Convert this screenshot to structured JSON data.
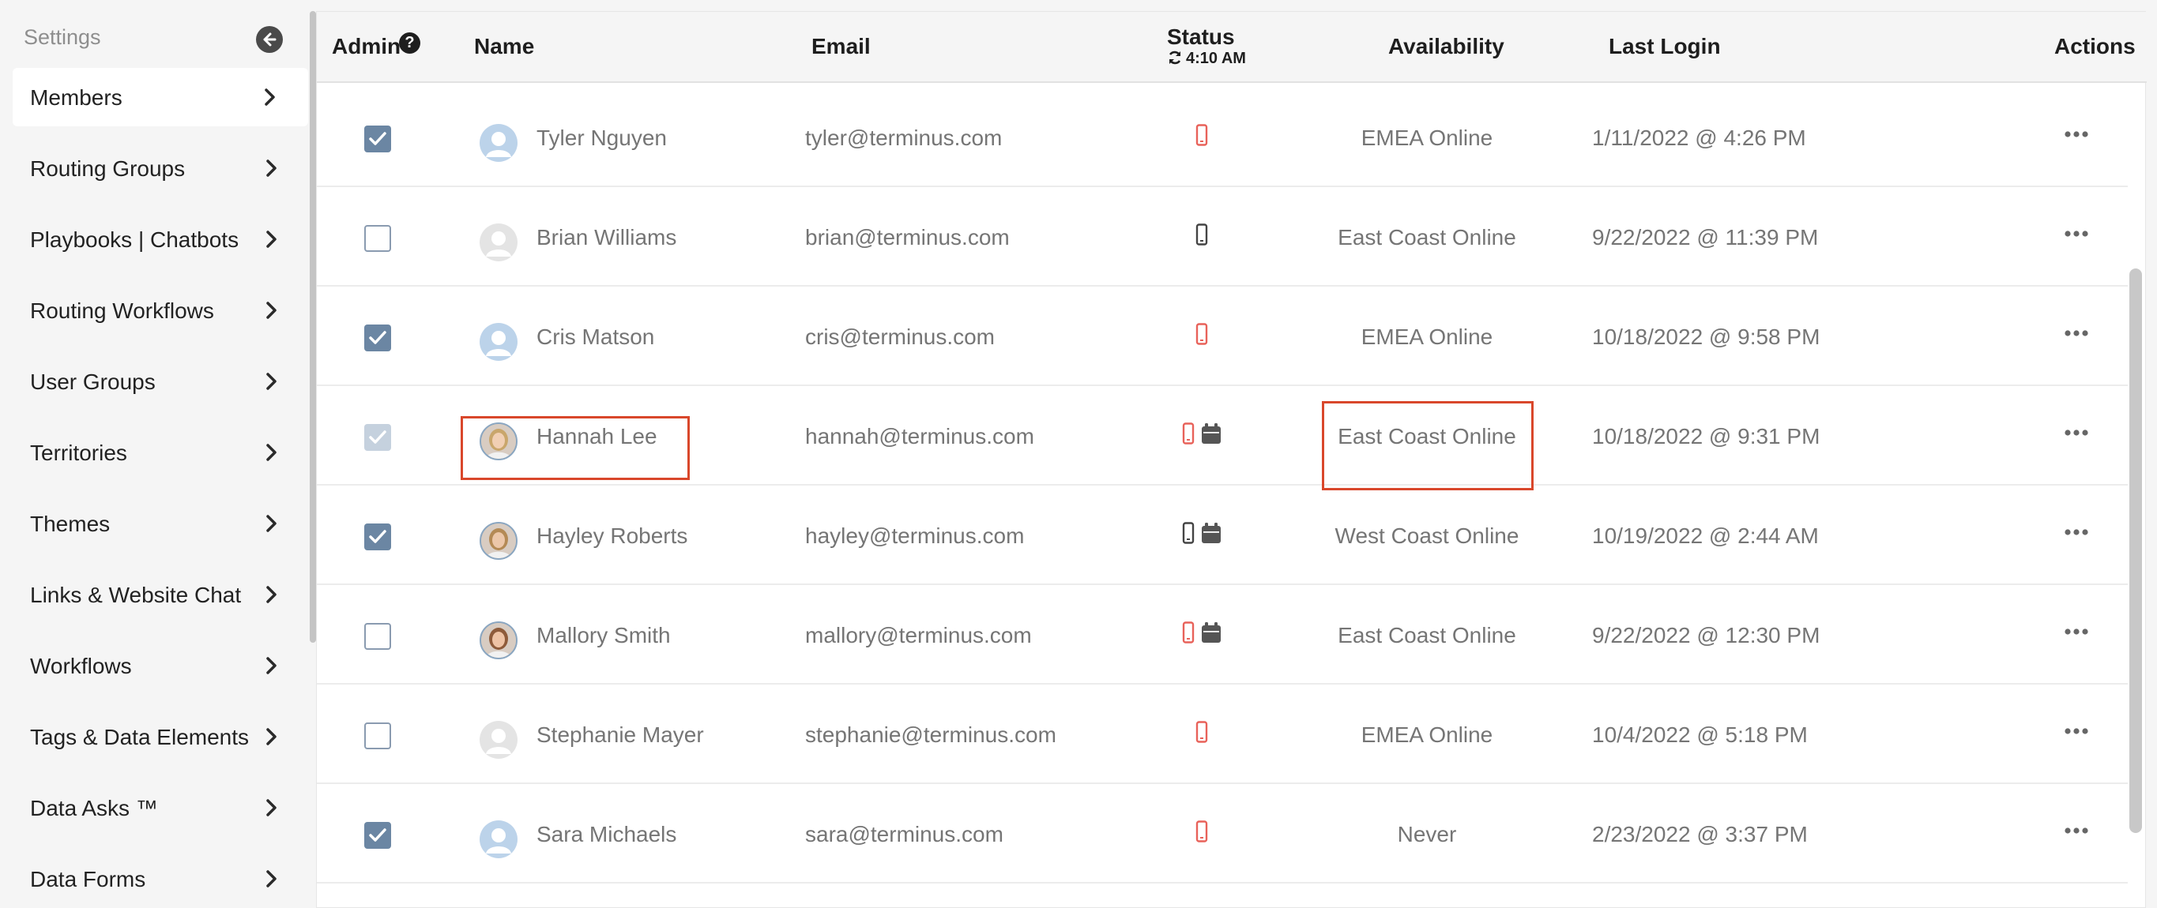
{
  "sidebar": {
    "title": "Settings",
    "items": [
      {
        "label": "Members",
        "active": true
      },
      {
        "label": "Routing Groups"
      },
      {
        "label": "Playbooks | Chatbots"
      },
      {
        "label": "Routing Workflows"
      },
      {
        "label": "User Groups"
      },
      {
        "label": "Territories"
      },
      {
        "label": "Themes"
      },
      {
        "label": "Links & Website Chat"
      },
      {
        "label": "Workflows"
      },
      {
        "label": "Tags & Data Elements"
      },
      {
        "label": "Data Asks ™"
      },
      {
        "label": "Data Forms"
      }
    ]
  },
  "table": {
    "headers": {
      "admin": "Admin",
      "name": "Name",
      "email": "Email",
      "status": "Status",
      "status_time": "4:10 AM",
      "availability": "Availability",
      "last_login": "Last Login",
      "actions": "Actions"
    },
    "rows": [
      {
        "admin": "checked",
        "avatar": "default-blue",
        "name": "Tyler Nguyen",
        "email": "tyler@terminus.com",
        "status": [
          "phone-red"
        ],
        "availability": "EMEA Online",
        "last_login": "1/11/2022 @ 4:26 PM"
      },
      {
        "admin": "unchecked",
        "avatar": "default-grey",
        "name": "Brian Williams",
        "email": "brian@terminus.com",
        "status": [
          "phone-dark"
        ],
        "availability": "East Coast Online",
        "last_login": "9/22/2022 @ 11:39 PM"
      },
      {
        "admin": "checked",
        "avatar": "default-blue",
        "name": "Cris Matson",
        "email": "cris@terminus.com",
        "status": [
          "phone-red"
        ],
        "availability": "EMEA Online",
        "last_login": "10/18/2022 @ 9:58 PM"
      },
      {
        "admin": "checked-disabled",
        "avatar": "photo",
        "name": "Hannah Lee",
        "email": "hannah@terminus.com",
        "status": [
          "phone-red",
          "calendar"
        ],
        "availability": "East Coast Online",
        "last_login": "10/18/2022 @ 9:31 PM",
        "highlighted": true
      },
      {
        "admin": "checked",
        "avatar": "photo",
        "name": "Hayley Roberts",
        "email": "hayley@terminus.com",
        "status": [
          "phone-dark",
          "calendar"
        ],
        "availability": "West Coast Online",
        "last_login": "10/19/2022 @ 2:44 AM"
      },
      {
        "admin": "unchecked",
        "avatar": "photo",
        "name": "Mallory Smith",
        "email": "mallory@terminus.com",
        "status": [
          "phone-red",
          "calendar"
        ],
        "availability": "East Coast Online",
        "last_login": "9/22/2022 @ 12:30 PM"
      },
      {
        "admin": "unchecked",
        "avatar": "default-grey",
        "name": "Stephanie Mayer",
        "email": "stephanie@terminus.com",
        "status": [
          "phone-red"
        ],
        "availability": "EMEA Online",
        "last_login": "10/4/2022 @ 5:18 PM"
      },
      {
        "admin": "checked",
        "avatar": "default-blue",
        "name": "Sara Michaels",
        "email": "sara@terminus.com",
        "status": [
          "phone-red"
        ],
        "availability": "Never",
        "last_login": "2/23/2022 @ 3:37 PM"
      }
    ]
  },
  "colors": {
    "highlight": "#d9472b",
    "phone_red": "#e8625a",
    "checkbox_checked": "#6b86a3",
    "avatar_blue": "#bcd3ea"
  }
}
